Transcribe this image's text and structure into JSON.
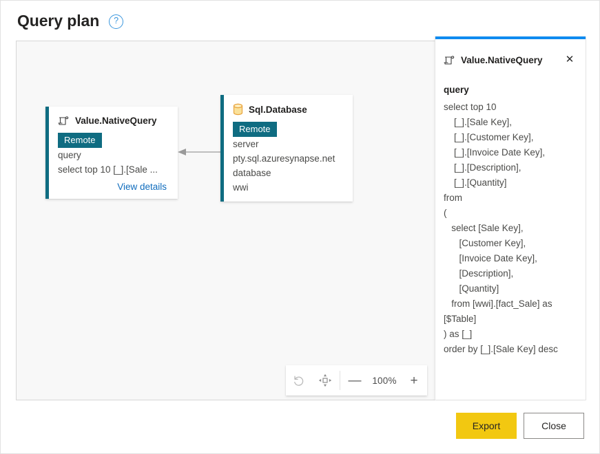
{
  "header": {
    "title": "Query plan",
    "help_icon": "question-circle-icon",
    "help_label": "?"
  },
  "canvas": {
    "nodes": [
      {
        "id": "value-native-query",
        "icon": "scroll-icon",
        "title": "Value.NativeQuery",
        "badge": "Remote",
        "accent_color": "#0F6C81",
        "fields": [
          {
            "key": "query",
            "value": "select top 10 [_].[Sale ..."
          }
        ],
        "link_label": "View details"
      },
      {
        "id": "sql-database",
        "icon": "database-icon",
        "title": "Sql.Database",
        "badge": "Remote",
        "accent_color": "#0F6C81",
        "fields": [
          {
            "key": "server",
            "value": "pty.sql.azuresynapse.net"
          },
          {
            "key": "database",
            "value": "wwi"
          }
        ],
        "link_label": ""
      }
    ],
    "edge": {
      "name": "connector-arrow",
      "direction": "left",
      "from": "sql-database",
      "to": "value-native-query"
    }
  },
  "zoom_toolbar": {
    "reset_icon": "undo-reset-icon",
    "fit_icon": "fit-to-screen-icon",
    "zoom_out_label": "—",
    "zoom_in_label": "+",
    "zoom_level": "100%"
  },
  "details_panel": {
    "accent_color": "#0F8BF0",
    "icon": "scroll-icon",
    "title": "Value.NativeQuery",
    "close_icon": "close-icon",
    "close_label": "✕",
    "field_label": "query",
    "query_text": "select top 10\n    [_].[Sale Key],\n    [_].[Customer Key],\n    [_].[Invoice Date Key],\n    [_].[Description],\n    [_].[Quantity]\nfrom\n(\n   select [Sale Key],\n      [Customer Key],\n      [Invoice Date Key],\n      [Description],\n      [Quantity]\n   from [wwi].[fact_Sale] as [$Table]\n) as [_]\norder by [_].[Sale Key] desc"
  },
  "footer": {
    "export_label": "Export",
    "export_color": "#F2C811",
    "close_label": "Close"
  }
}
